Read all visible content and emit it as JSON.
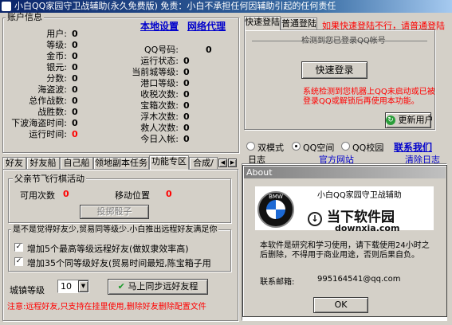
{
  "window": {
    "title": "小白QQ家园守卫战辅助(永久免费版) 免责：小白不承担任何因辅助引起的任何责任"
  },
  "account": {
    "group_label": "账户信息",
    "settings_link": "本地设置",
    "proxy_link": "网络代理",
    "col1": [
      {
        "label": "用户:",
        "value": "0"
      },
      {
        "label": "等级:",
        "value": "0"
      },
      {
        "label": "金币:",
        "value": "0"
      },
      {
        "label": "银元:",
        "value": "0"
      },
      {
        "label": "分数:",
        "value": "0"
      },
      {
        "label": "海盗波:",
        "value": "0"
      },
      {
        "label": "总作战数:",
        "value": "0"
      },
      {
        "label": "战胜数:",
        "value": "0"
      },
      {
        "label": "下波海盗时间:",
        "value": "0"
      },
      {
        "label": "运行时间:",
        "value": "0"
      }
    ],
    "col2": [
      {
        "label": "QQ号码:",
        "value": "0"
      },
      {
        "label": "运行状态:",
        "value": "0"
      },
      {
        "label": "当前城等级:",
        "value": "0"
      },
      {
        "label": "港口等级:",
        "value": "0"
      },
      {
        "label": "收税次数:",
        "value": "0"
      },
      {
        "label": "宝箱次数:",
        "value": "0"
      },
      {
        "label": "浮木次数:",
        "value": "0"
      },
      {
        "label": "救人次数:",
        "value": "0"
      },
      {
        "label": "今日入帐:",
        "value": "0"
      }
    ]
  },
  "login": {
    "tabs": [
      "快速登陆",
      "普通登陆"
    ],
    "warning": "如果快速登陆不行，请普通登陆",
    "detected": "检测到您已登录QQ帐号",
    "quick_login_button": "快速登录",
    "help": "系统检测到您机器上QQ未启动或已被登录QQ或解锁后再使用本功能。",
    "refresh_button": "更新用户"
  },
  "mode": {
    "options": [
      "双模式",
      "QQ空间",
      "QQ校园"
    ],
    "selected": 1,
    "contact_link": "联系我们"
  },
  "log": {
    "label": "日志",
    "site_link": "官方网站",
    "clear_link": "清除日志"
  },
  "bottom_tabs": [
    "好友",
    "好友船",
    "自己船",
    "领地副本任务",
    "功能专区",
    "合成/"
  ],
  "festival": {
    "group_label": "父亲节飞行棋活动",
    "available_label": "可用次数",
    "available_value": "0",
    "position_label": "移动位置",
    "position_value": "0",
    "dice_button": "投掷骰子"
  },
  "upgrade": {
    "group_label": "是不是觉得好友少,贸易同等级少.小白推出远程好友满足你",
    "option1": "增加5个最高等级远程好友(做奴隶效率高)",
    "option2": "增加35个同等级好友(贸易时间最短,陈宝箱子用",
    "city_level_label": "城镇等级",
    "city_level_value": "10",
    "sync_button": "马上同步远好友程",
    "note": "注意:远程好友,只支持在挂里使用,删除好友删除配置文件"
  },
  "about": {
    "title": "About",
    "app_name": "小白QQ家园守卫战辅助",
    "logo_text": "BMW",
    "brand_cn": "当下软件园",
    "brand_url": "downxia.com",
    "body": "本软件是研究和学习使用，请下载使用24小时之后删除，不得用于商业用途，否则后果自负。",
    "email_label": "联系邮箱:",
    "email": "995164541@qq.com",
    "ok_button": "OK"
  }
}
